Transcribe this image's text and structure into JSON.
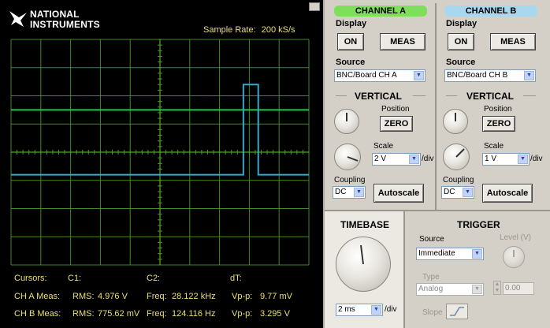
{
  "logo": {
    "line1": "NATIONAL",
    "line2": "INSTRUMENTS"
  },
  "scope": {
    "sample_rate_label": "Sample Rate:",
    "sample_rate_value": "200 kS/s",
    "colors": {
      "background": "#000000",
      "grid": "#4a9a2a",
      "channel_a": "#22c845",
      "channel_b": "#3aa8c8",
      "text": "#e8e070"
    }
  },
  "cursors": {
    "title": "Cursors:",
    "c1": "C1:",
    "c2": "C2:",
    "dt": "dT:",
    "rows": [
      {
        "label": "CH A Meas:",
        "rms_label": "RMS:",
        "rms": "4.976 V",
        "freq_label": "Freq:",
        "freq": "28.122 kHz",
        "vpp_label": "Vp-p:",
        "vpp": "9.77 mV"
      },
      {
        "label": "CH B Meas:",
        "rms_label": "RMS:",
        "rms": "775.62 mV",
        "freq_label": "Freq:",
        "freq": "124.116 Hz",
        "vpp_label": "Vp-p:",
        "vpp": "3.295 V"
      }
    ]
  },
  "channel_a": {
    "title": "CHANNEL A",
    "display_label": "Display",
    "on_label": "ON",
    "meas_label": "MEAS",
    "source_label": "Source",
    "source_value": "BNC/Board CH A",
    "vertical_label": "VERTICAL",
    "position_label": "Position",
    "zero_label": "ZERO",
    "scale_label": "Scale",
    "scale_value": "2 V",
    "scale_unit": "/div",
    "coupling_label": "Coupling",
    "coupling_value": "DC",
    "autoscale_label": "Autoscale",
    "tab_color": "#7ee05a"
  },
  "channel_b": {
    "title": "CHANNEL B",
    "display_label": "Display",
    "on_label": "ON",
    "meas_label": "MEAS",
    "source_label": "Source",
    "source_value": "BNC/Board CH B",
    "vertical_label": "VERTICAL",
    "position_label": "Position",
    "zero_label": "ZERO",
    "scale_label": "Scale",
    "scale_value": "1 V",
    "scale_unit": "/div",
    "coupling_label": "Coupling",
    "coupling_value": "DC",
    "autoscale_label": "Autoscale",
    "tab_color": "#a8d8f0"
  },
  "timebase": {
    "title": "TIMEBASE",
    "value": "2 ms",
    "unit": "/div"
  },
  "trigger": {
    "title": "TRIGGER",
    "source_label": "Source",
    "source_value": "Immediate",
    "level_label": "Level (V)",
    "level_value": "0.00",
    "type_label": "Type",
    "type_value": "Analog",
    "slope_label": "Slope"
  }
}
